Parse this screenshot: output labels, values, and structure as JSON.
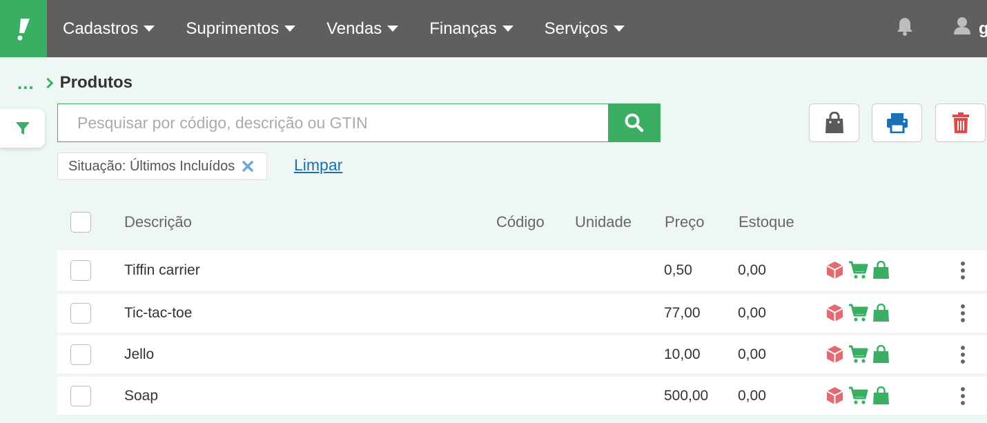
{
  "navbar": {
    "menu": [
      {
        "label": "Cadastros"
      },
      {
        "label": "Suprimentos"
      },
      {
        "label": "Vendas"
      },
      {
        "label": "Finanças"
      },
      {
        "label": "Serviços"
      }
    ],
    "user_initial": "g"
  },
  "breadcrumb": {
    "ellipsis": "...",
    "title": "Produtos"
  },
  "search": {
    "placeholder": "Pesquisar por código, descrição ou GTIN",
    "value": ""
  },
  "filters": {
    "chip_label": "Situação: Últimos Incluídos",
    "clear_label": "Limpar"
  },
  "table": {
    "headers": [
      "Descrição",
      "Código",
      "Unidade",
      "Preço",
      "Estoque"
    ],
    "rows": [
      {
        "descricao": "Tiffin carrier",
        "codigo": "",
        "unidade": "",
        "preco": "0,50",
        "estoque": "0,00"
      },
      {
        "descricao": "Tic-tac-toe",
        "codigo": "",
        "unidade": "",
        "preco": "77,00",
        "estoque": "0,00"
      },
      {
        "descricao": "Jello",
        "codigo": "",
        "unidade": "",
        "preco": "10,00",
        "estoque": "0,00"
      },
      {
        "descricao": "Soap",
        "codigo": "",
        "unidade": "",
        "preco": "500,00",
        "estoque": "0,00"
      }
    ]
  },
  "colors": {
    "brand_green": "#3aae63",
    "navbar_gray": "#5f5f5f",
    "link_blue": "#1a6fb5",
    "delete_red": "#e04848",
    "box_red": "#e06b70"
  },
  "icons": [
    "logo-icon",
    "bell-icon",
    "user-icon",
    "filter-icon",
    "search-icon",
    "bag-icon",
    "print-icon",
    "trash-icon",
    "close-icon",
    "box-icon",
    "cart-icon",
    "kebab-icon"
  ]
}
